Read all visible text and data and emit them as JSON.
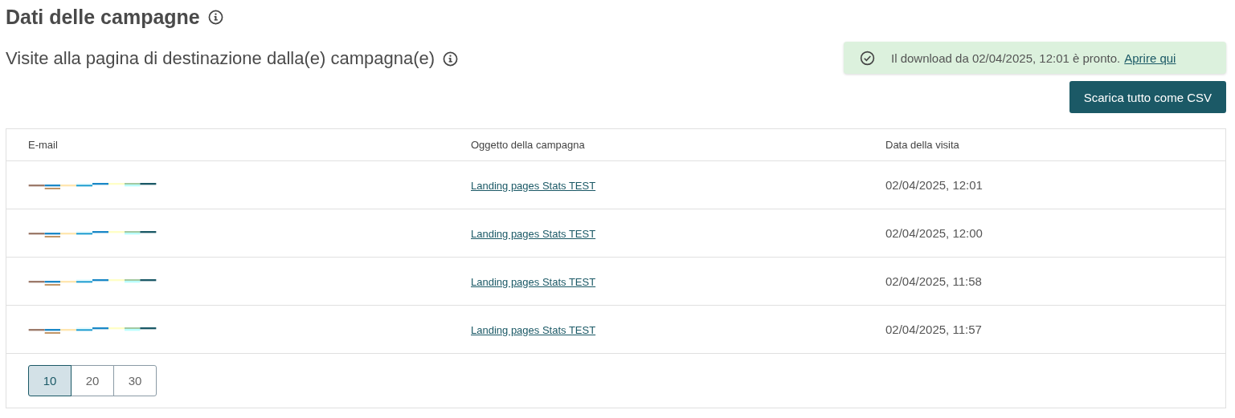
{
  "page_title": "Dati delle campagne",
  "section_title": "Visite alla pagina di destinazione dalla(e) campagna(e)",
  "alert": {
    "kind": "success",
    "message": "Il download da 02/04/2025, 12:01 è pronto.",
    "link": "Aprire qui"
  },
  "download_button": "Scarica tutto come CSV",
  "table": {
    "columns": [
      "E-mail",
      "Oggetto della campagna",
      "Data della visita"
    ],
    "rows": [
      {
        "email": {
          "kind": "redacted"
        },
        "subject": "Landing pages Stats TEST",
        "date": "02/04/2025, 12:01"
      },
      {
        "email": {
          "kind": "redacted"
        },
        "subject": "Landing pages Stats TEST",
        "date": "02/04/2025, 12:00"
      },
      {
        "email": {
          "kind": "redacted"
        },
        "subject": "Landing pages Stats TEST",
        "date": "02/04/2025, 11:58"
      },
      {
        "email": {
          "kind": "redacted"
        },
        "subject": "Landing pages Stats TEST",
        "date": "02/04/2025, 11:57"
      }
    ]
  },
  "page_sizes": [
    {
      "label": "10",
      "selected": true
    },
    {
      "label": "20",
      "selected": false
    },
    {
      "label": "30",
      "selected": false
    }
  ]
}
